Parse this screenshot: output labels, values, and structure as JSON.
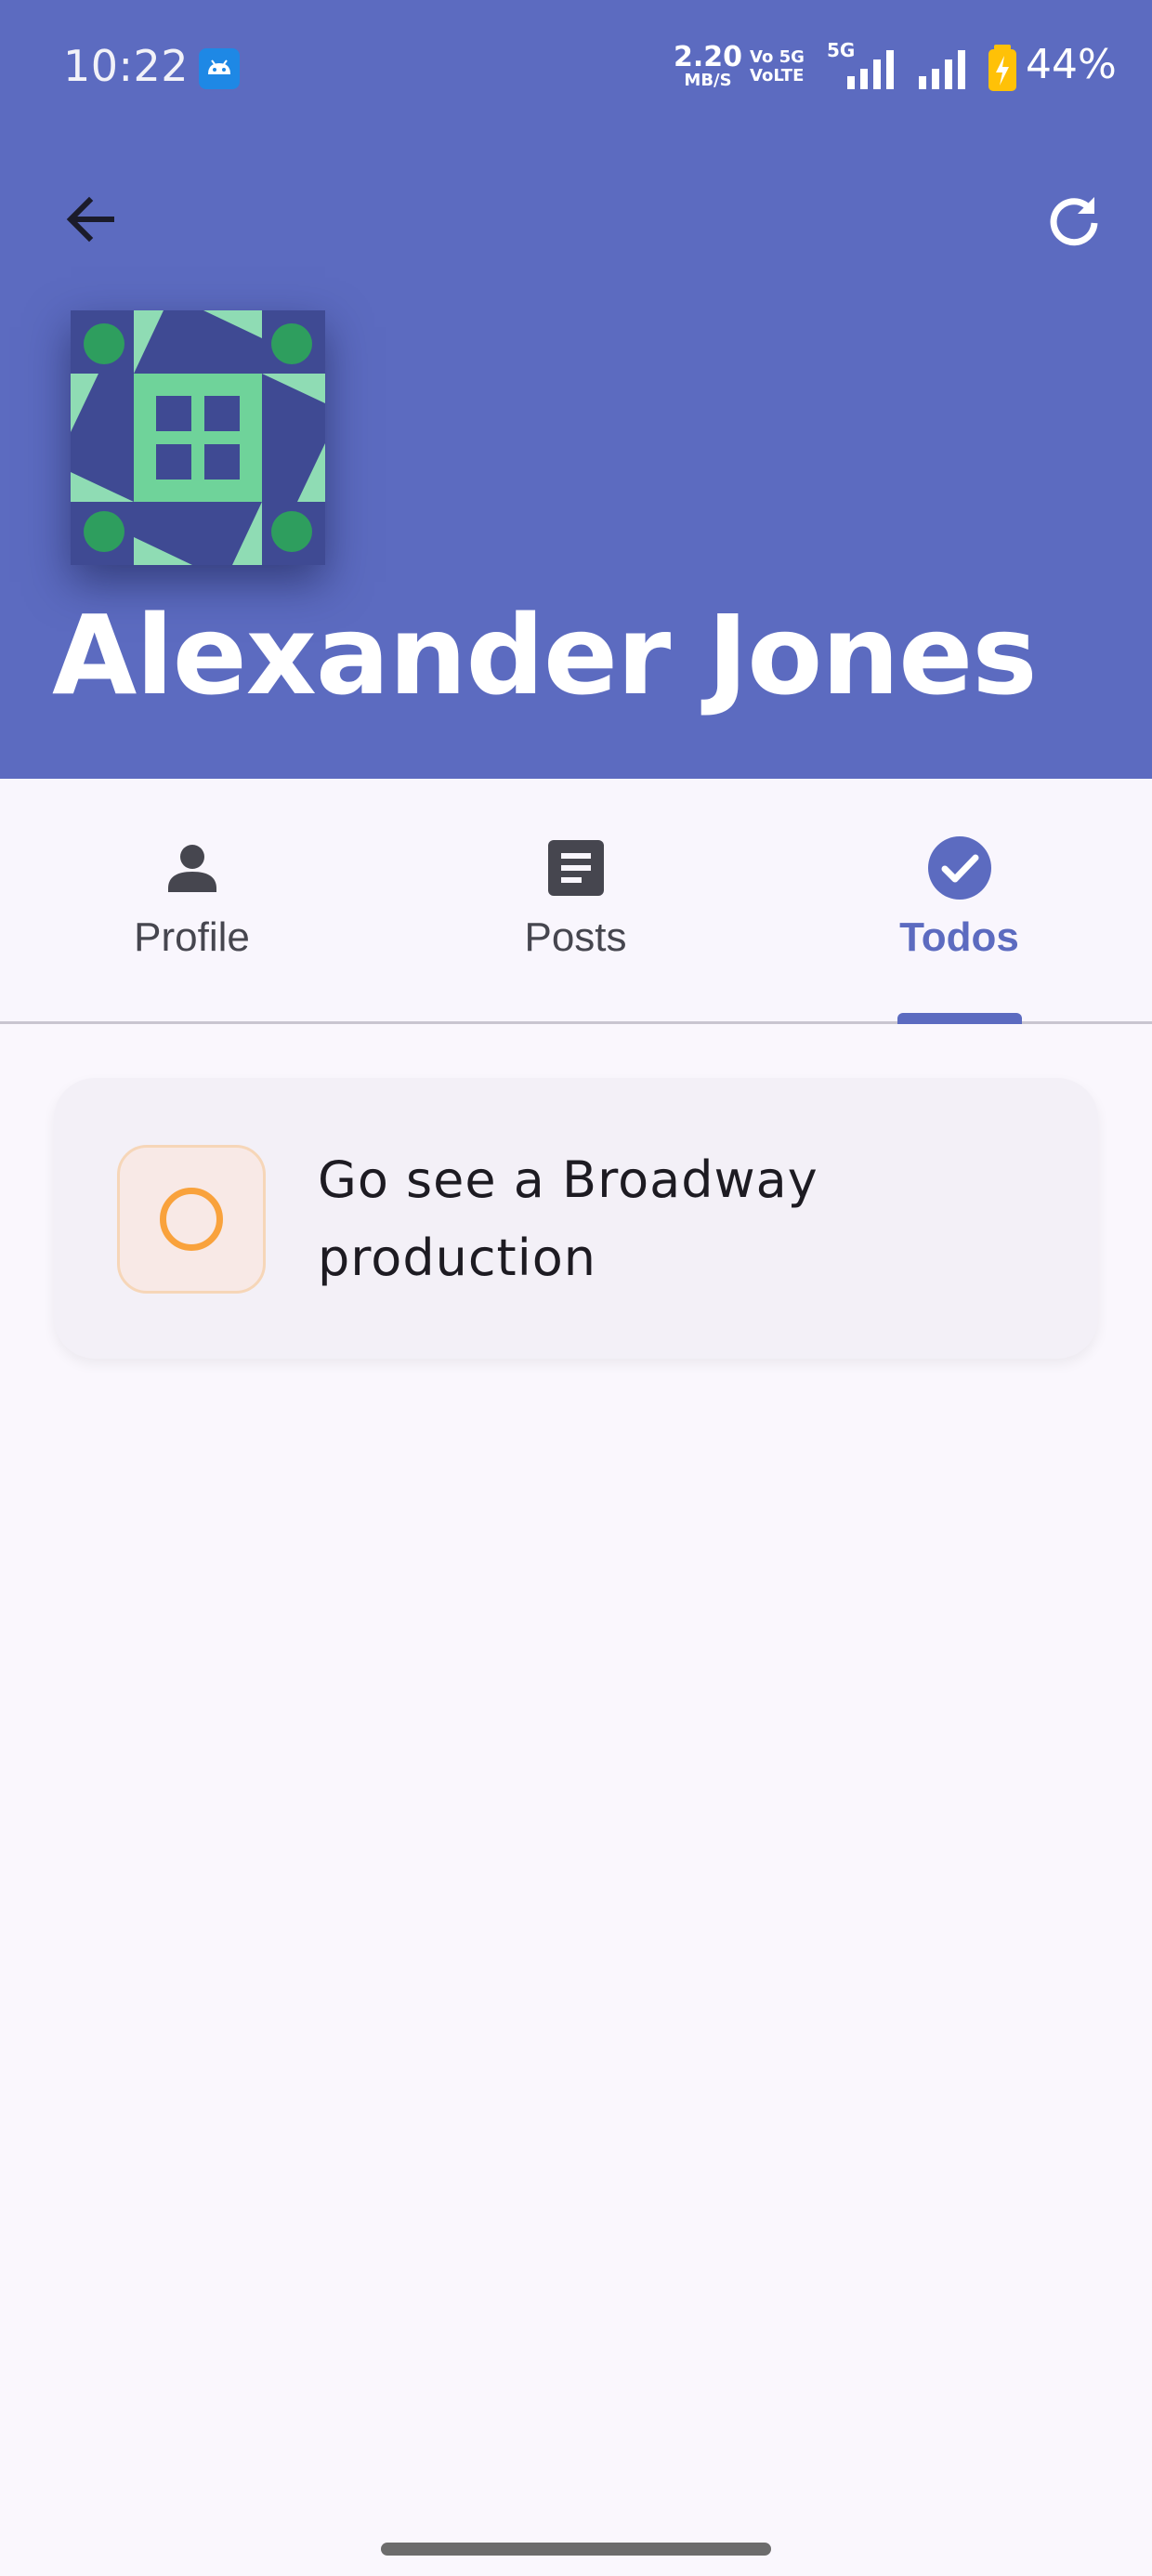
{
  "status_bar": {
    "time": "10:22",
    "net_speed_value": "2.20",
    "net_speed_unit": "MB/S",
    "volte_top": "Vo 5G",
    "volte_bottom": "VoLTE",
    "signal_5g_label": "5G",
    "battery_percent": "44%"
  },
  "header": {
    "user_name": "Alexander Jones",
    "back_icon": "arrow-left-icon",
    "refresh_icon": "refresh-icon",
    "background_color": "#5c6bc0"
  },
  "tabs": [
    {
      "label": "Profile",
      "icon": "person-icon",
      "active": false
    },
    {
      "label": "Posts",
      "icon": "article-icon",
      "active": false
    },
    {
      "label": "Todos",
      "icon": "check-circle-icon",
      "active": true
    }
  ],
  "todos": [
    {
      "title": "Go see a Broadway production",
      "completed": false
    }
  ],
  "colors": {
    "accent": "#5c6bc0",
    "todo_pending": "#f9a23c",
    "avatar_light": "#8fdcb4",
    "avatar_dark": "#2e9e5e"
  }
}
